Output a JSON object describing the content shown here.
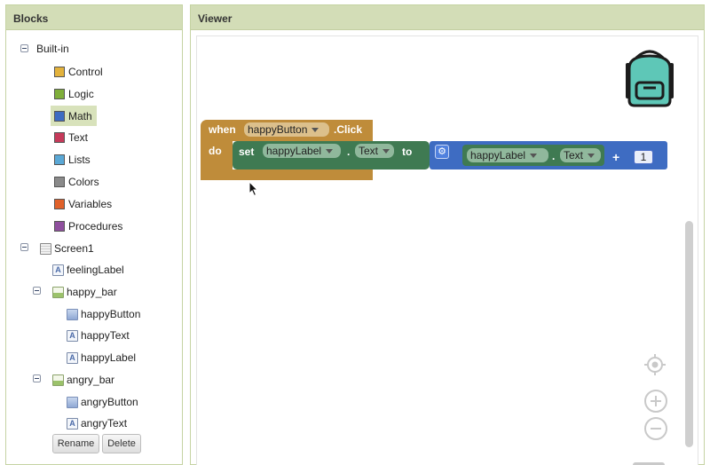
{
  "blocks_panel": {
    "title": "Blocks",
    "builtin": {
      "label": "Built-in",
      "items": [
        {
          "label": "Control",
          "color": "#e3b23c"
        },
        {
          "label": "Logic",
          "color": "#7fae3a"
        },
        {
          "label": "Math",
          "color": "#3e6cc2"
        },
        {
          "label": "Text",
          "color": "#c63a5a"
        },
        {
          "label": "Lists",
          "color": "#5aa8d6"
        },
        {
          "label": "Colors",
          "color": "#8a8a8a"
        },
        {
          "label": "Variables",
          "color": "#e0612a"
        },
        {
          "label": "Procedures",
          "color": "#8f4f9e"
        }
      ]
    },
    "screen": {
      "label": "Screen1",
      "items": [
        {
          "label": "feelingLabel"
        },
        {
          "label": "happy_bar"
        },
        {
          "label": "happyButton"
        },
        {
          "label": "happyText"
        },
        {
          "label": "happyLabel"
        },
        {
          "label": "angry_bar"
        },
        {
          "label": "angryButton"
        },
        {
          "label": "angryText"
        }
      ]
    },
    "rename_label": "Rename",
    "delete_label": "Delete"
  },
  "viewer": {
    "title": "Viewer",
    "event_block": {
      "when": "when",
      "component": "happyButton",
      "event": ".Click",
      "do": "do",
      "color": "#bf8c3a"
    },
    "set_block": {
      "set": "set",
      "component": "happyLabel",
      "dot": ".",
      "property": "Text",
      "to": "to",
      "color": "#3f7a52"
    },
    "add_block": {
      "plus": "+",
      "color": "#3e6cc2"
    },
    "getter_block": {
      "component": "happyLabel",
      "dot": ".",
      "property": "Text",
      "color": "#3f7a52"
    },
    "number_block": {
      "value": "1"
    }
  }
}
